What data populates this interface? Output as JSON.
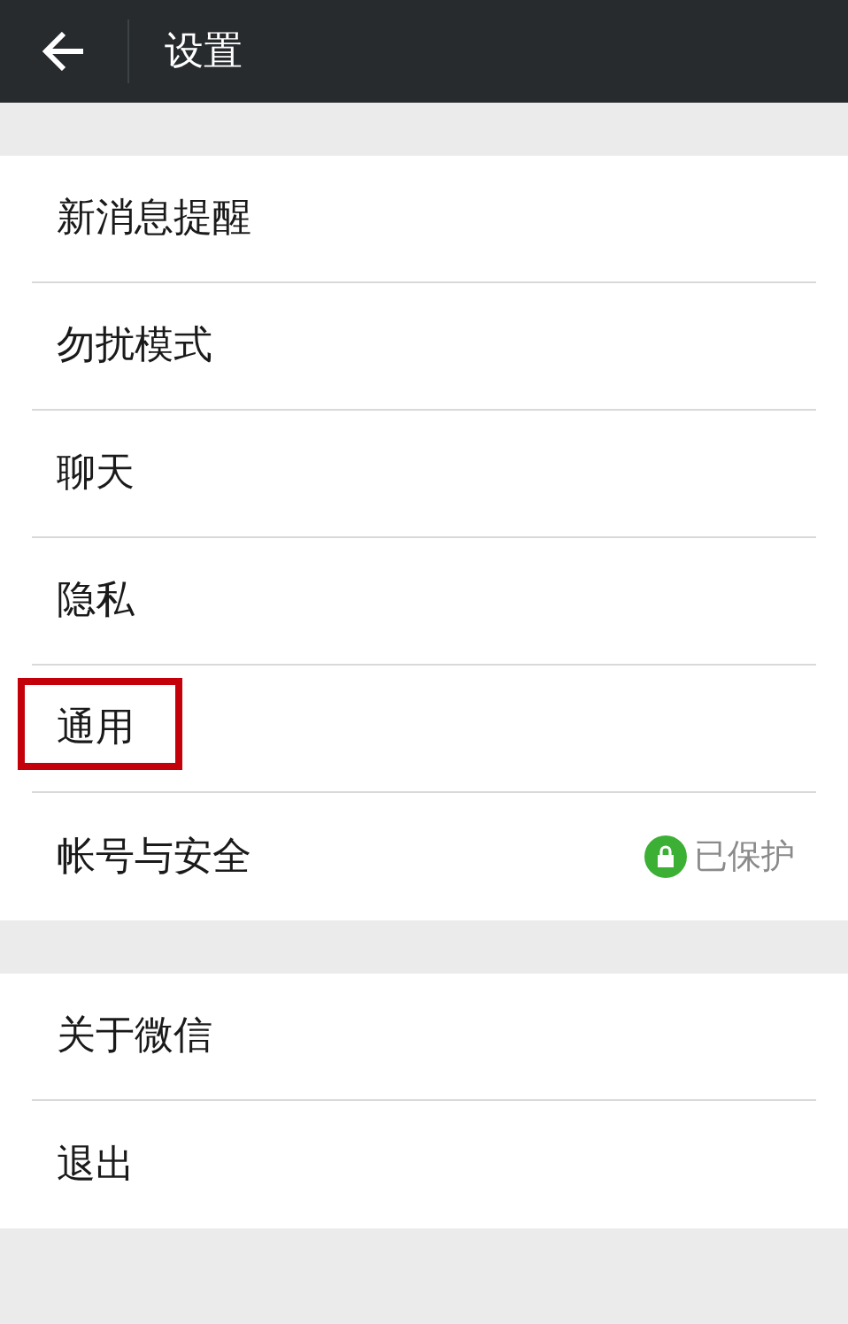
{
  "header": {
    "title": "设置"
  },
  "groups": [
    [
      {
        "label": "新消息提醒",
        "highlighted": false
      },
      {
        "label": "勿扰模式",
        "highlighted": false
      },
      {
        "label": "聊天",
        "highlighted": false
      },
      {
        "label": "隐私",
        "highlighted": false
      },
      {
        "label": "通用",
        "highlighted": true
      },
      {
        "label": "帐号与安全",
        "highlighted": false,
        "status": "已保护"
      }
    ],
    [
      {
        "label": "关于微信",
        "highlighted": false
      },
      {
        "label": "退出",
        "highlighted": false
      }
    ]
  ]
}
